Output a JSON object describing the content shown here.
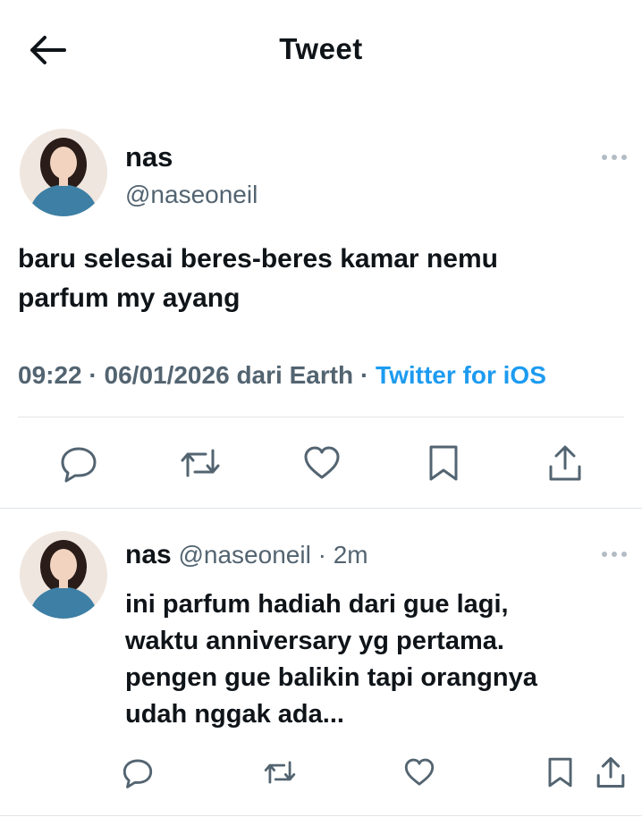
{
  "header": {
    "title": "Tweet"
  },
  "tweet": {
    "name": "nas",
    "handle": "@naseoneil",
    "text_line1": "baru selesai beres-beres kamar nemu",
    "text_line2": "parfum my ayang",
    "time": "09:22",
    "date": "06/01/2026",
    "location_prefix": "dari",
    "location": "Earth",
    "sep": "·",
    "client": "Twitter for iOS"
  },
  "reply": {
    "name": "nas",
    "handle": "@naseoneil",
    "sep": "·",
    "age": "2m",
    "lines": [
      "ini parfum hadiah dari gue lagi,",
      "waktu anniversary yg pertama.",
      "pengen gue balikin tapi orangnya",
      "udah nggak ada..."
    ]
  },
  "icons": [
    "back-arrow-icon",
    "more-icon",
    "reply-icon",
    "retweet-icon",
    "like-icon",
    "bookmark-icon",
    "share-icon"
  ],
  "colors": {
    "text": "#0f1419",
    "secondary": "#536471",
    "link": "#1d9bf0",
    "divider": "#e1e5e8"
  }
}
